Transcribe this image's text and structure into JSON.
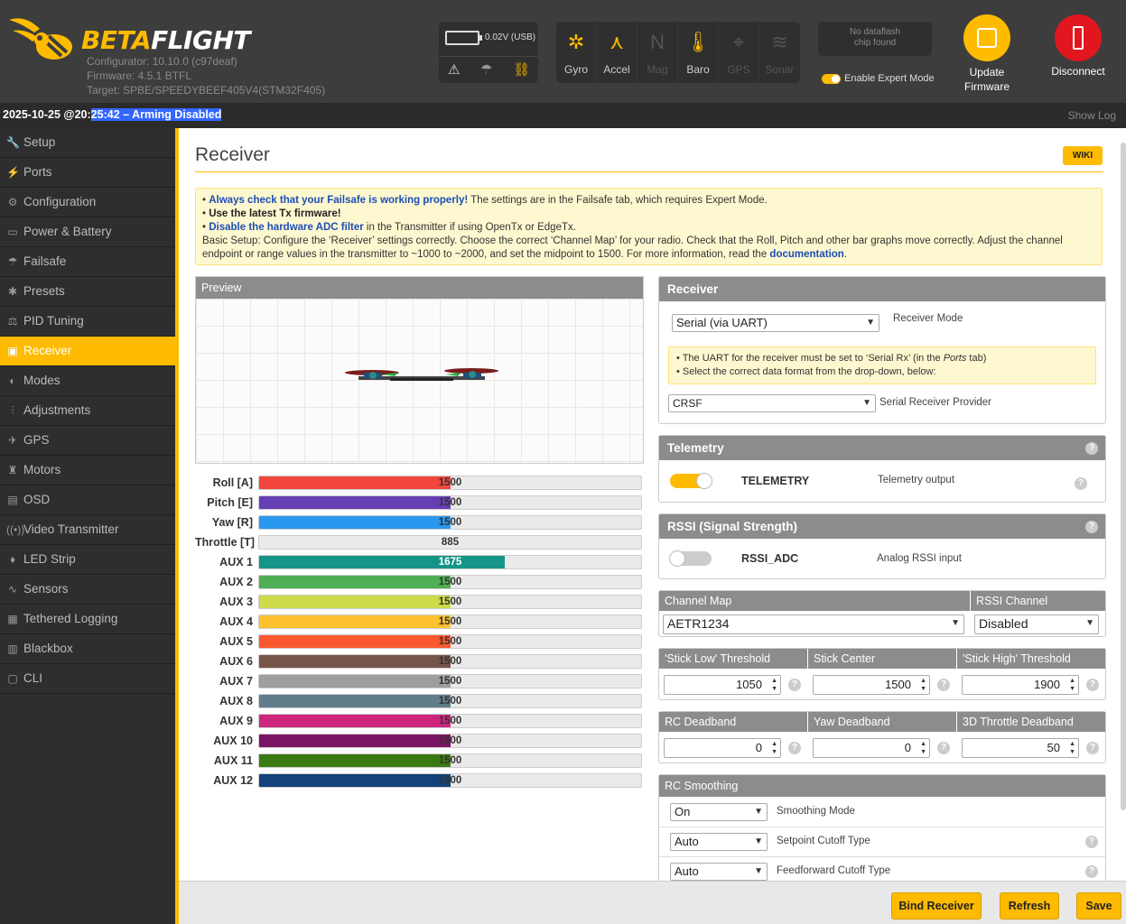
{
  "header": {
    "brand_a": "BETA",
    "brand_b": "FLIGHT",
    "configurator": "Configurator: 10.10.0 (c97deaf)",
    "firmware": "Firmware: 4.5.1 BTFL",
    "target": "Target: SPBE/SPEEDYBEEF405V4(STM32F405)",
    "battery_voltage": "0.02V (USB)",
    "sensors": [
      {
        "label": "Gyro",
        "icon": "gyro-icon",
        "state": "on"
      },
      {
        "label": "Accel",
        "icon": "accel-icon",
        "state": "on"
      },
      {
        "label": "Mag",
        "icon": "mag-icon",
        "state": "off"
      },
      {
        "label": "Baro",
        "icon": "baro-icon",
        "state": "on"
      },
      {
        "label": "GPS",
        "icon": "gps-icon",
        "state": "off"
      },
      {
        "label": "Sonar",
        "icon": "sonar-icon",
        "state": "off"
      }
    ],
    "dataflash_line1": "No dataflash",
    "dataflash_line2": "chip found",
    "expert_mode_label": "Enable Expert Mode",
    "update_label_1": "Update",
    "update_label_2": "Firmware",
    "disconnect_label": "Disconnect"
  },
  "statusbar": {
    "prefix": "2025-10-25 @20:",
    "selected": "25:42 – Arming Disabled",
    "show_log": "Show Log"
  },
  "sidebar": {
    "items": [
      {
        "label": "Setup",
        "icon": "wrench-icon"
      },
      {
        "label": "Ports",
        "icon": "plug-icon"
      },
      {
        "label": "Configuration",
        "icon": "gear-icon"
      },
      {
        "label": "Power & Battery",
        "icon": "battery-icon"
      },
      {
        "label": "Failsafe",
        "icon": "parachute-icon"
      },
      {
        "label": "Presets",
        "icon": "presets-icon"
      },
      {
        "label": "PID Tuning",
        "icon": "pid-icon"
      },
      {
        "label": "Receiver",
        "icon": "receiver-icon"
      },
      {
        "label": "Modes",
        "icon": "modes-icon"
      },
      {
        "label": "Adjustments",
        "icon": "sliders-icon"
      },
      {
        "label": "GPS",
        "icon": "satellite-icon"
      },
      {
        "label": "Motors",
        "icon": "motor-icon"
      },
      {
        "label": "OSD",
        "icon": "osd-icon"
      },
      {
        "label": "Video Transmitter",
        "icon": "broadcast-icon"
      },
      {
        "label": "LED Strip",
        "icon": "led-icon"
      },
      {
        "label": "Sensors",
        "icon": "pulse-icon"
      },
      {
        "label": "Tethered Logging",
        "icon": "logging-icon"
      },
      {
        "label": "Blackbox",
        "icon": "blackbox-icon"
      },
      {
        "label": "CLI",
        "icon": "terminal-icon"
      }
    ],
    "active": "Receiver"
  },
  "page": {
    "title": "Receiver",
    "wiki": "WIKI",
    "note_1_link": "Always check that your Failsafe is working properly!",
    "note_1_text": " The settings are in the Failsafe tab, which requires Expert Mode.",
    "note_2": "Use the latest Tx firmware!",
    "note_3_link": "Disable the hardware ADC filter",
    "note_3_text": " in the Transmitter if using OpenTx or EdgeTx.",
    "note_4": "Basic Setup: Configure the ‘Receiver’ settings correctly. Choose the correct ‘Channel Map’ for your radio. Check that the Roll, Pitch and other bar graphs move correctly. Adjust the channel endpoint or range values in the transmitter to ~1000 to ~2000, and set the midpoint to 1500. For more information, read the ",
    "note_4_link": "documentation",
    "note_4_end": ".",
    "preview_title": "Preview"
  },
  "channels": [
    {
      "label": "Roll [A]",
      "value": 1500,
      "display": "1500",
      "color": "#f1453d"
    },
    {
      "label": "Pitch [E]",
      "value": 1500,
      "display": "1500",
      "color": "#673fb4"
    },
    {
      "label": "Yaw [R]",
      "value": 1500,
      "display": "1500",
      "color": "#2b98f0"
    },
    {
      "label": "Throttle [T]",
      "value": 885,
      "display": "885",
      "color": "#1fbcd2"
    },
    {
      "label": "AUX 1",
      "value": 1675,
      "display": "1675",
      "color": "#159588"
    },
    {
      "label": "AUX 2",
      "value": 1500,
      "display": "1500",
      "color": "#50ae55"
    },
    {
      "label": "AUX 3",
      "value": 1500,
      "display": "1500",
      "color": "#cdda49"
    },
    {
      "label": "AUX 4",
      "value": 1500,
      "display": "1500",
      "color": "#fdc02f"
    },
    {
      "label": "AUX 5",
      "value": 1500,
      "display": "1500",
      "color": "#fc5830"
    },
    {
      "label": "AUX 6",
      "value": 1500,
      "display": "1500",
      "color": "#785549"
    },
    {
      "label": "AUX 7",
      "value": 1500,
      "display": "1500",
      "color": "#9e9e9e"
    },
    {
      "label": "AUX 8",
      "value": 1500,
      "display": "1500",
      "color": "#617d8a"
    },
    {
      "label": "AUX 9",
      "value": 1500,
      "display": "1500",
      "color": "#cf267d"
    },
    {
      "label": "AUX 10",
      "value": 1500,
      "display": "1500",
      "color": "#7a1464"
    },
    {
      "label": "AUX 11",
      "value": 1500,
      "display": "1500",
      "color": "#3a7a14"
    },
    {
      "label": "AUX 12",
      "value": 1500,
      "display": "1500",
      "color": "#14427a"
    }
  ],
  "channel_range": [
    885,
    2115
  ],
  "receiver": {
    "title": "Receiver",
    "mode_value": "Serial (via UART)",
    "mode_label": "Receiver Mode",
    "hint_1": "• The UART for the receiver must be set to ‘Serial Rx’ (in the ",
    "hint_1_italic": "Ports",
    "hint_1_end": " tab)",
    "hint_2": "• Select the correct data format from the drop-down, below:",
    "provider_value": "CRSF",
    "provider_label": "Serial Receiver Provider"
  },
  "telemetry": {
    "title": "Telemetry",
    "name": "TELEMETRY",
    "desc": "Telemetry output",
    "enabled": true
  },
  "rssi": {
    "title": "RSSI (Signal Strength)",
    "name": "RSSI_ADC",
    "desc": "Analog RSSI input",
    "enabled": false
  },
  "channel_map": {
    "label": "Channel Map",
    "value": "AETR1234",
    "rssi_label": "RSSI Channel",
    "rssi_value": "Disabled"
  },
  "thresholds": {
    "low_label": "'Stick Low' Threshold",
    "low_value": "1050",
    "center_label": "Stick Center",
    "center_value": "1500",
    "high_label": "'Stick High' Threshold",
    "high_value": "1900"
  },
  "deadband": {
    "rc_label": "RC Deadband",
    "rc_value": "0",
    "yaw_label": "Yaw Deadband",
    "yaw_value": "0",
    "throttle_label": "3D Throttle Deadband",
    "throttle_value": "50"
  },
  "smoothing": {
    "title": "RC Smoothing",
    "mode_value": "On",
    "mode_label": "Smoothing Mode",
    "setpoint_value": "Auto",
    "setpoint_label": "Setpoint Cutoff Type",
    "ff_value": "Auto",
    "ff_label": "Feedforward Cutoff Type"
  },
  "actions": {
    "bind": "Bind Receiver",
    "refresh": "Refresh",
    "save": "Save"
  },
  "colors": {
    "accent": "#ffbb00",
    "disconnect": "#e2161f"
  }
}
